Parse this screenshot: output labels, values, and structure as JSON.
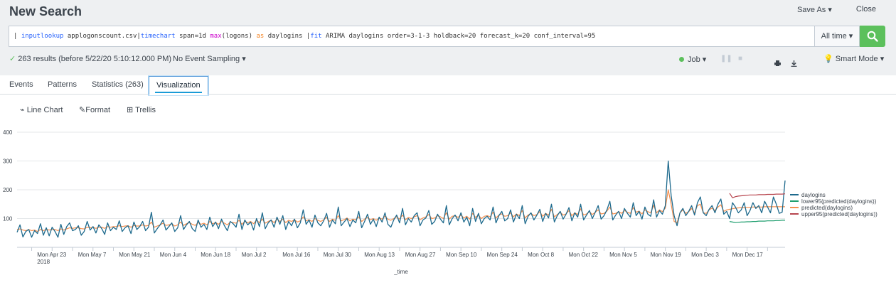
{
  "header": {
    "title": "New Search",
    "save_as": "Save As ▾",
    "close": "Close"
  },
  "search": {
    "tokens": [
      {
        "t": "| ",
        "c": "plain"
      },
      {
        "t": "inputlookup",
        "c": "cmd"
      },
      {
        "t": " applogonscount.csv|",
        "c": "plain"
      },
      {
        "t": "timechart",
        "c": "cmd"
      },
      {
        "t": " span=1d ",
        "c": "plain"
      },
      {
        "t": "max",
        "c": "fn"
      },
      {
        "t": "(logons) ",
        "c": "plain"
      },
      {
        "t": "as",
        "c": "as"
      },
      {
        "t": " daylogins |",
        "c": "plain"
      },
      {
        "t": "fit",
        "c": "cmd"
      },
      {
        "t": " ARIMA daylogins order=3-1-3 holdback=20 forecast_k=20 conf_interval=95",
        "c": "plain"
      }
    ],
    "time_range": "All time ▾"
  },
  "status": {
    "results": "263 results (before 5/22/20 5:10:12.000 PM)",
    "sampling": "No Event Sampling ▾",
    "job": "Job ▾",
    "mode": "Smart Mode ▾"
  },
  "tabs": [
    {
      "label": "Events"
    },
    {
      "label": "Patterns"
    },
    {
      "label": "Statistics (263)"
    },
    {
      "label": "Visualization",
      "active": true
    }
  ],
  "viz_toolbar": {
    "line_chart": "Line Chart",
    "format": "Format",
    "trellis": "Trellis"
  },
  "chart_data": {
    "type": "line",
    "xlabel": "_time",
    "ylabel": "",
    "ylim": [
      0,
      400
    ],
    "yticks": [
      100,
      200,
      300,
      400
    ],
    "x_start": "2018-04-11",
    "x_end": "2018-12-30",
    "x_tick_labels": [
      "Mon Apr 23\n2018",
      "Mon May 7",
      "Mon May 21",
      "Mon Jun 4",
      "Mon Jun 18",
      "Mon Jul 2",
      "Mon Jul 16",
      "Mon Jul 30",
      "Mon Aug 13",
      "Mon Aug 27",
      "Mon Sep 10",
      "Mon Sep 24",
      "Mon Oct 8",
      "Mon Oct 22",
      "Mon Nov 5",
      "Mon Nov 19",
      "Mon Dec 3",
      "Mon Dec 17"
    ],
    "legend_position": "right",
    "series": [
      {
        "name": "daylogins",
        "color": "#1e6a8d",
        "start": "2018-04-11",
        "values": [
          52,
          78,
          36,
          55,
          62,
          35,
          58,
          48,
          82,
          42,
          68,
          40,
          70,
          55,
          35,
          80,
          45,
          72,
          85,
          58,
          62,
          75,
          42,
          55,
          90,
          60,
          72,
          50,
          78,
          65,
          45,
          85,
          58,
          70,
          62,
          92,
          55,
          68,
          75,
          48,
          88,
          62,
          72,
          90,
          58,
          70,
          122,
          50,
          65,
          78,
          95,
          60,
          72,
          85,
          55,
          68,
          110,
          62,
          78,
          90,
          65,
          55,
          95,
          70,
          80,
          62,
          105,
          72,
          88,
          65,
          98,
          75,
          58,
          90,
          82,
          70,
          115,
          62,
          95,
          78,
          88,
          60,
          100,
          72,
          120,
          65,
          85,
          95,
          70,
          105,
          80,
          110,
          62,
          90,
          75,
          98,
          68,
          85,
          130,
          80,
          95,
          70,
          112,
          85,
          75,
          92,
          118,
          70,
          95,
          82,
          140,
          75,
          88,
          100,
          72,
          95,
          85,
          125,
          68,
          90,
          115,
          80,
          98,
          72,
          105,
          88,
          120,
          80,
          70,
          95,
          112,
          85,
          135,
          78,
          100,
          88,
          110,
          120,
          75,
          95,
          102,
          128,
          80,
          90,
          115,
          98,
          85,
          145,
          78,
          100,
          112,
          92,
          120,
          88,
          105,
          75,
          135,
          90,
          118,
          82,
          100,
          108,
          95,
          140,
          85,
          110,
          125,
          92,
          100,
          130,
          88,
          115,
          100,
          145,
          82,
          108,
          120,
          95,
          112,
          132,
          90,
          118,
          102,
          150,
          88,
          110,
          125,
          98,
          115,
          138,
          92,
          120,
          105,
          150,
          95,
          112,
          128,
          100,
          122,
          145,
          98,
          110,
          130,
          160,
          95,
          112,
          125,
          100,
          135,
          118,
          105,
          155,
          110,
          125,
          98,
          140,
          115,
          108,
          165,
          105,
          128,
          115,
          145,
          300,
          180,
          110,
          75,
          120,
          135,
          110,
          125,
          145,
          112,
          155,
          175,
          120,
          110,
          132,
          145,
          120,
          150,
          168,
          115,
          125,
          100,
          155,
          140,
          120,
          130,
          155,
          110,
          128,
          155,
          135,
          145,
          120,
          160,
          140,
          120,
          175,
          150,
          118,
          122,
          232
        ]
      },
      {
        "name": "lower95(predicted(daylogins))",
        "color": "#1e9e6e",
        "start": "2018-12-11",
        "values": [
          90,
          88,
          86,
          87,
          88,
          88,
          89,
          89,
          90,
          90,
          91,
          91,
          91,
          92,
          92,
          92,
          93,
          93,
          94,
          94
        ]
      },
      {
        "name": "predicted(daylogins)",
        "color": "#f58f4e",
        "start": "2018-04-11",
        "values": [
          62,
          64,
          60,
          58,
          62,
          58,
          60,
          55,
          62,
          58,
          62,
          60,
          62,
          62,
          58,
          64,
          60,
          64,
          68,
          66,
          68,
          68,
          65,
          64,
          70,
          68,
          70,
          66,
          70,
          70,
          66,
          72,
          70,
          72,
          72,
          75,
          72,
          74,
          75,
          70,
          76,
          74,
          74,
          78,
          74,
          76,
          88,
          70,
          74,
          78,
          84,
          76,
          78,
          82,
          74,
          78,
          88,
          76,
          82,
          86,
          80,
          76,
          86,
          80,
          84,
          78,
          90,
          82,
          86,
          80,
          90,
          84,
          78,
          88,
          86,
          84,
          94,
          80,
          90,
          86,
          90,
          82,
          94,
          86,
          98,
          84,
          90,
          94,
          86,
          98,
          90,
          98,
          86,
          94,
          90,
          96,
          88,
          92,
          106,
          92,
          96,
          90,
          100,
          94,
          90,
          96,
          104,
          90,
          98,
          94,
          110,
          92,
          96,
          102,
          92,
          98,
          96,
          106,
          90,
          98,
          104,
          96,
          100,
          94,
          102,
          98,
          108,
          98,
          94,
          100,
          106,
          98,
          112,
          96,
          104,
          100,
          106,
          110,
          96,
          102,
          106,
          114,
          100,
          102,
          110,
          106,
          100,
          120,
          98,
          108,
          110,
          104,
          112,
          102,
          108,
          98,
          118,
          104,
          112,
          100,
          108,
          110,
          106,
          122,
          102,
          112,
          116,
          108,
          110,
          120,
          106,
          116,
          110,
          128,
          102,
          112,
          118,
          110,
          114,
          124,
          108,
          118,
          112,
          132,
          106,
          114,
          122,
          112,
          116,
          128,
          110,
          120,
          114,
          134,
          112,
          116,
          124,
          114,
          122,
          130,
          116,
          118,
          126,
          140,
          116,
          118,
          124,
          118,
          128,
          122,
          118,
          138,
          122,
          126,
          116,
          130,
          124,
          120,
          146,
          120,
          130,
          124,
          136,
          200,
          150,
          90,
          85,
          120,
          130,
          118,
          124,
          135,
          120,
          145,
          150,
          120,
          118,
          130,
          136,
          128,
          140,
          148,
          125,
          130,
          132,
          134,
          136,
          137,
          138,
          138,
          139,
          139,
          140,
          140,
          140,
          140,
          141,
          141,
          141,
          141,
          141,
          141,
          141,
          141
        ]
      },
      {
        "name": "upper95(predicted(daylogins))",
        "color": "#b7454e",
        "start": "2018-12-11",
        "values": [
          188,
          172,
          176,
          178,
          179,
          180,
          181,
          182,
          182,
          182,
          183,
          183,
          183,
          184,
          184,
          184,
          185,
          185,
          185,
          186
        ]
      }
    ]
  }
}
